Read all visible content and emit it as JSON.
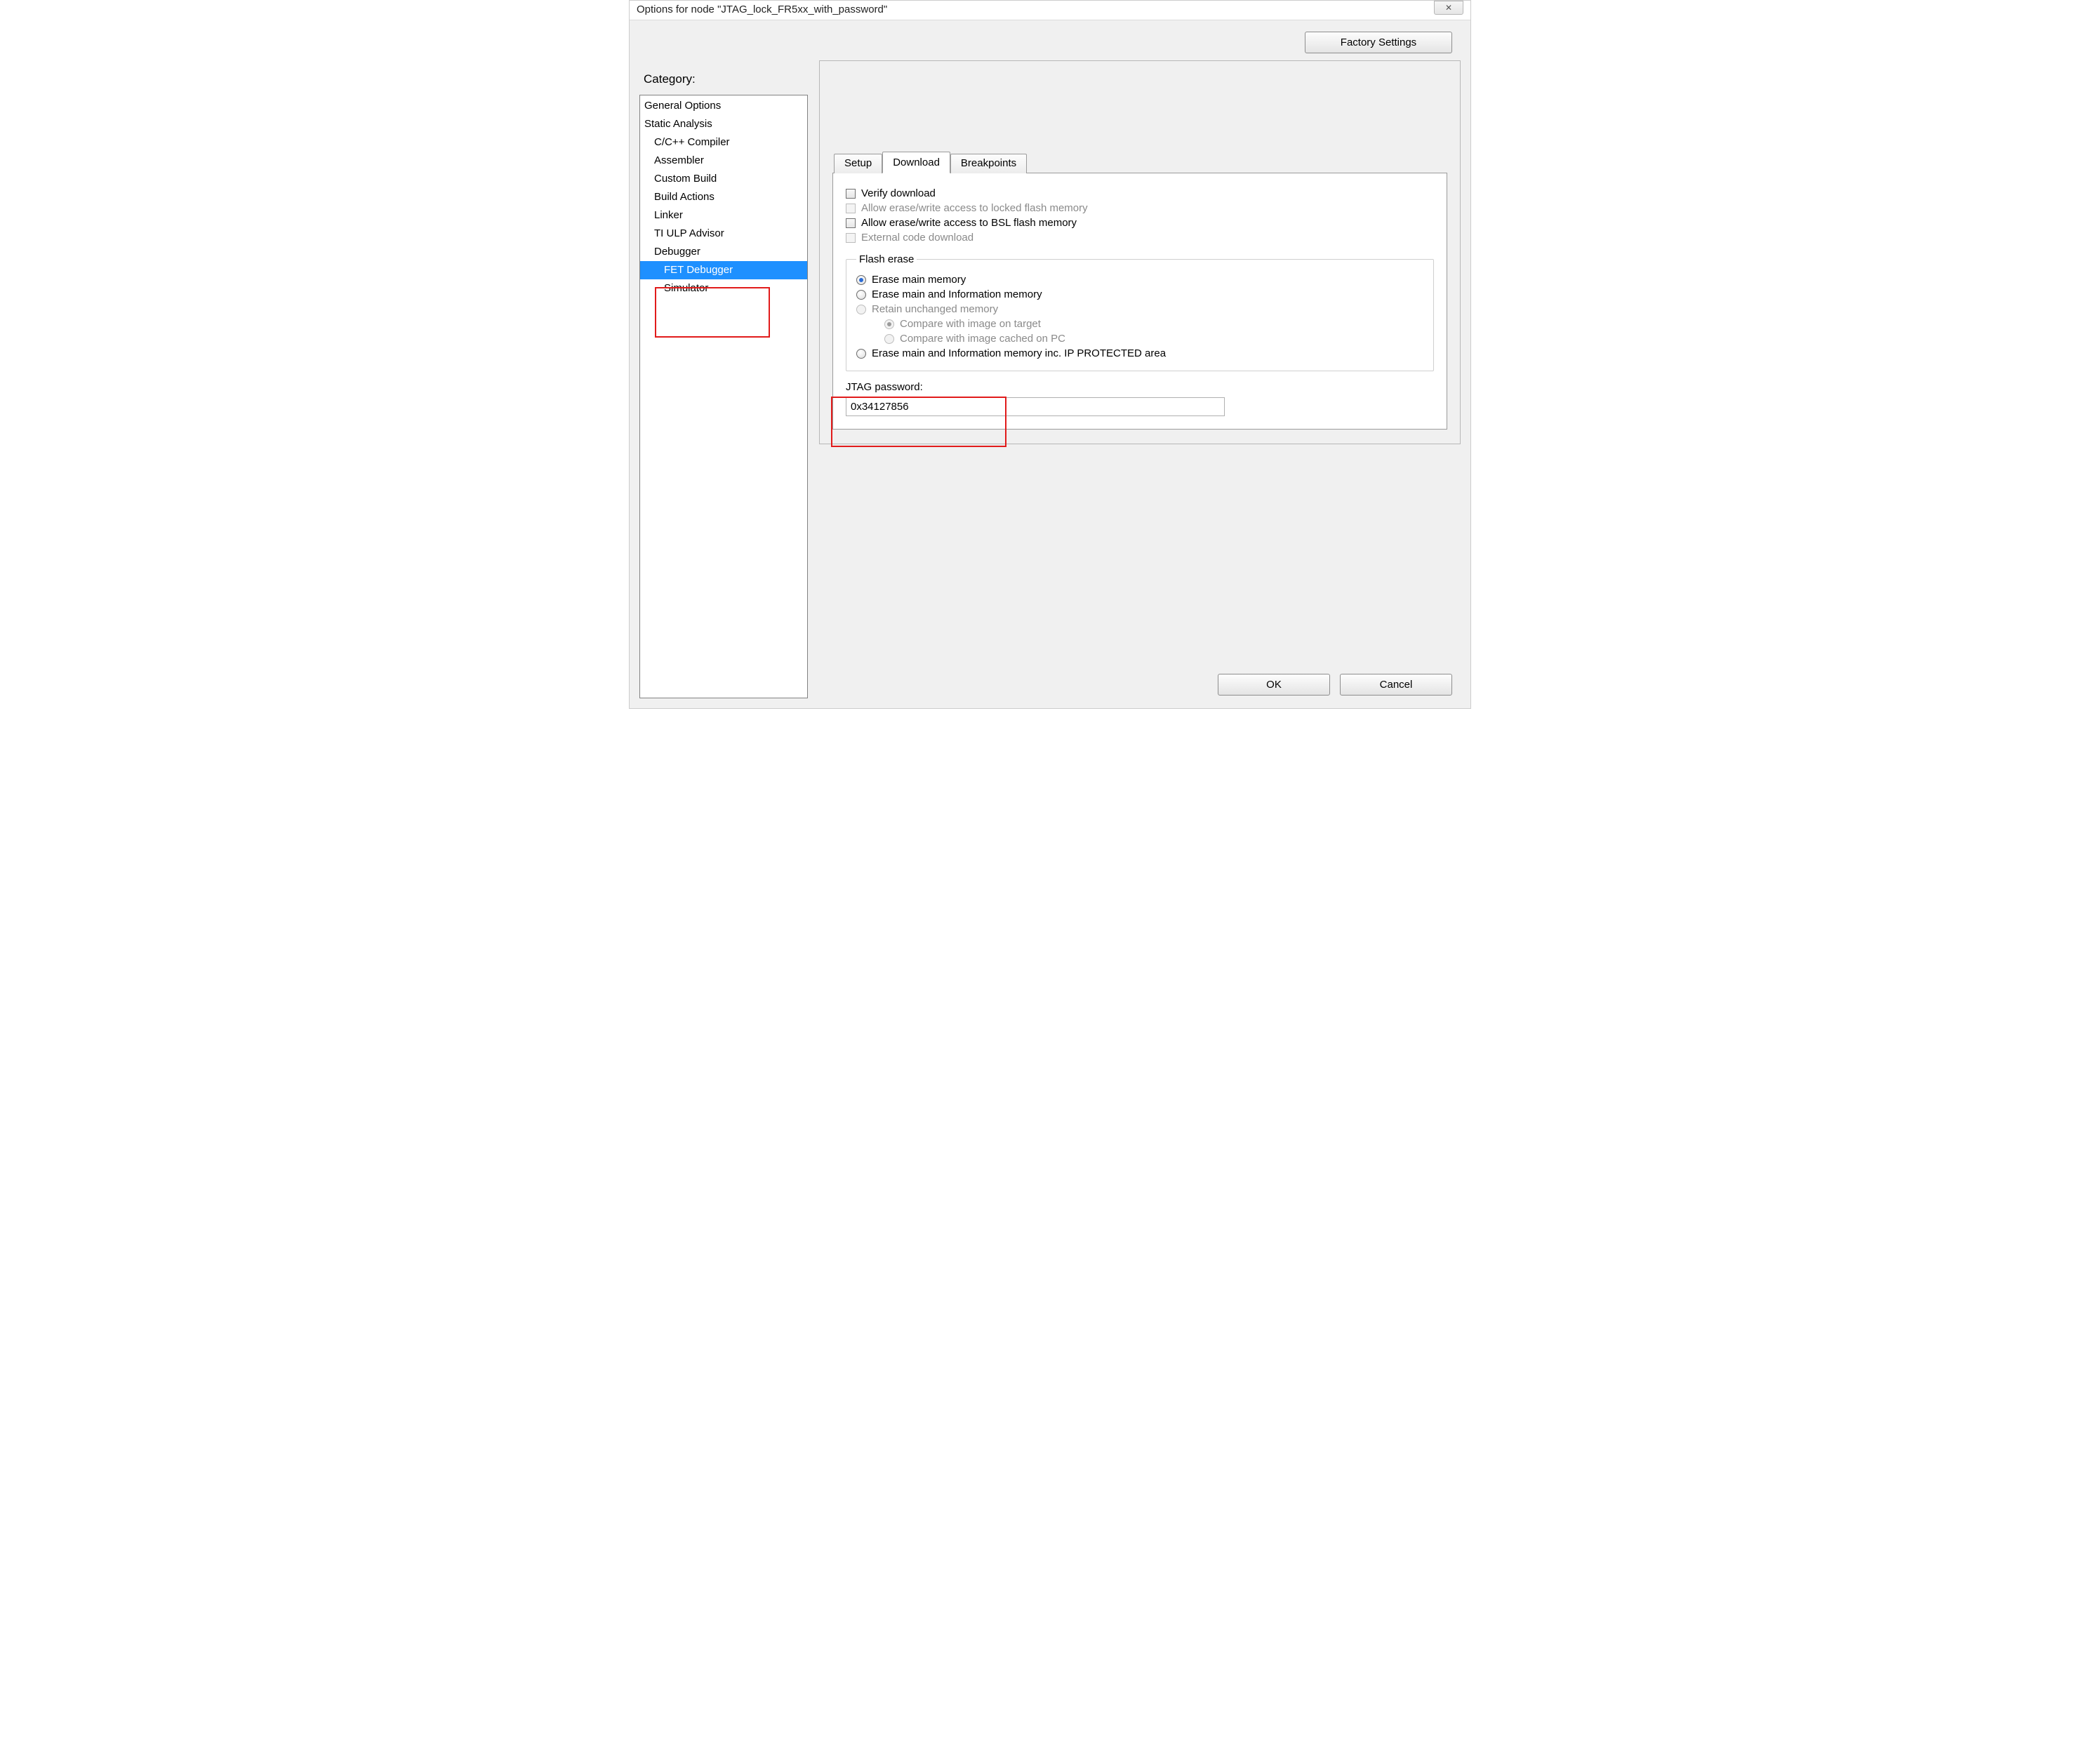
{
  "window": {
    "title": "Options for node \"JTAG_lock_FR5xx_with_password\""
  },
  "buttons": {
    "factory_settings": "Factory Settings",
    "ok": "OK",
    "cancel": "Cancel"
  },
  "category": {
    "label": "Category:",
    "items": [
      {
        "label": "General Options",
        "indent": 0
      },
      {
        "label": "Static Analysis",
        "indent": 0
      },
      {
        "label": "C/C++ Compiler",
        "indent": 1
      },
      {
        "label": "Assembler",
        "indent": 1
      },
      {
        "label": "Custom Build",
        "indent": 1
      },
      {
        "label": "Build Actions",
        "indent": 1
      },
      {
        "label": "Linker",
        "indent": 1
      },
      {
        "label": "TI ULP Advisor",
        "indent": 1
      },
      {
        "label": "Debugger",
        "indent": 1
      },
      {
        "label": "FET Debugger",
        "indent": 2,
        "selected": true
      },
      {
        "label": "Simulator",
        "indent": 2
      }
    ]
  },
  "tabs": {
    "setup": "Setup",
    "download": "Download",
    "breakpoints": "Breakpoints",
    "active": "download"
  },
  "download": {
    "verify": "Verify download",
    "allow_locked": "Allow erase/write access to locked flash memory",
    "allow_bsl": "Allow erase/write access to BSL flash memory",
    "external_code": "External code download",
    "flash_erase_legend": "Flash erase",
    "erase_main": "Erase main memory",
    "erase_main_info": "Erase main and Information memory",
    "retain_unchanged": "Retain unchanged memory",
    "compare_target": "Compare with image on target",
    "compare_cached": "Compare with image cached on PC",
    "erase_ip_protected": "Erase main and Information memory inc. IP PROTECTED area",
    "jtag_label": "JTAG password:",
    "jtag_value": "0x34127856"
  }
}
